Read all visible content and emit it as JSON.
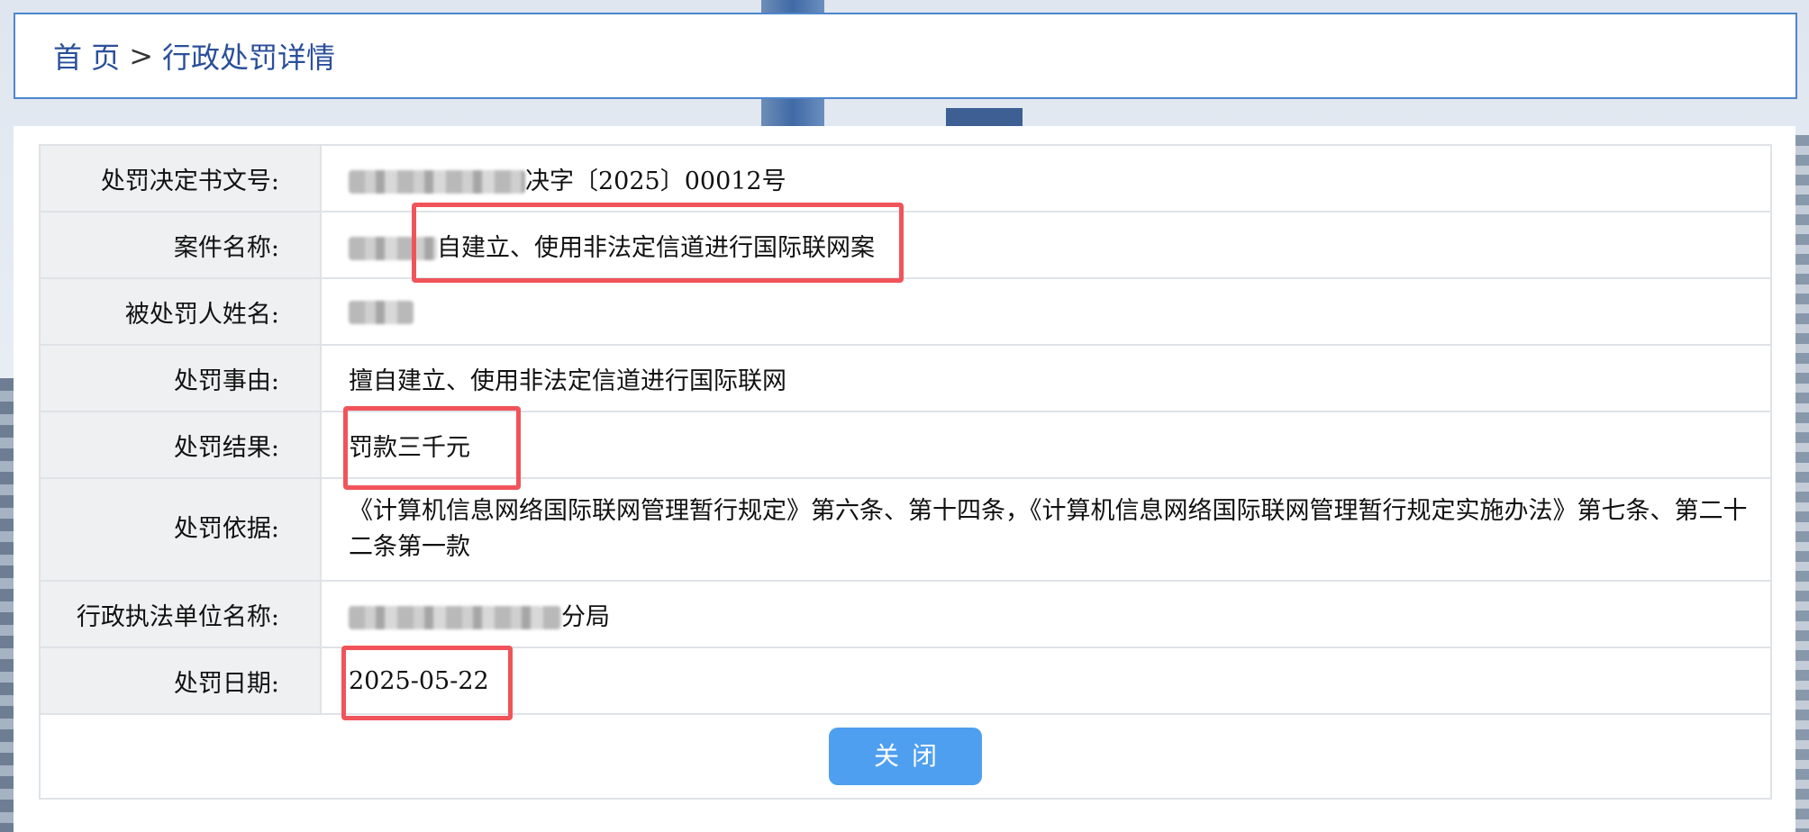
{
  "breadcrumb": {
    "home": "首 页",
    "separator": ">",
    "current": "行政处罚详情"
  },
  "details": {
    "rows": [
      {
        "label": "处罚决定书文号:",
        "value": "决字〔2025〕00012号"
      },
      {
        "label": "案件名称:",
        "value": "自建立、使用非法定信道进行国际联网案"
      },
      {
        "label": "被处罚人姓名:",
        "value": ""
      },
      {
        "label": "处罚事由:",
        "value": "擅自建立、使用非法定信道进行国际联网"
      },
      {
        "label": "处罚结果:",
        "value": "罚款三千元"
      },
      {
        "label": "处罚依据:",
        "value": "《计算机信息网络国际联网管理暂行规定》第六条、第十四条，《计算机信息网络国际联网管理暂行规定实施办法》第七条、第二十二条第一款"
      },
      {
        "label": "行政执法单位名称:",
        "value": "分局"
      },
      {
        "label": "处罚日期:",
        "value": "2025-05-22"
      }
    ]
  },
  "actions": {
    "close_label": "关闭"
  },
  "colors": {
    "highlight": "#f0545a",
    "button": "#4f9ff0",
    "link": "#2a4f9a"
  }
}
